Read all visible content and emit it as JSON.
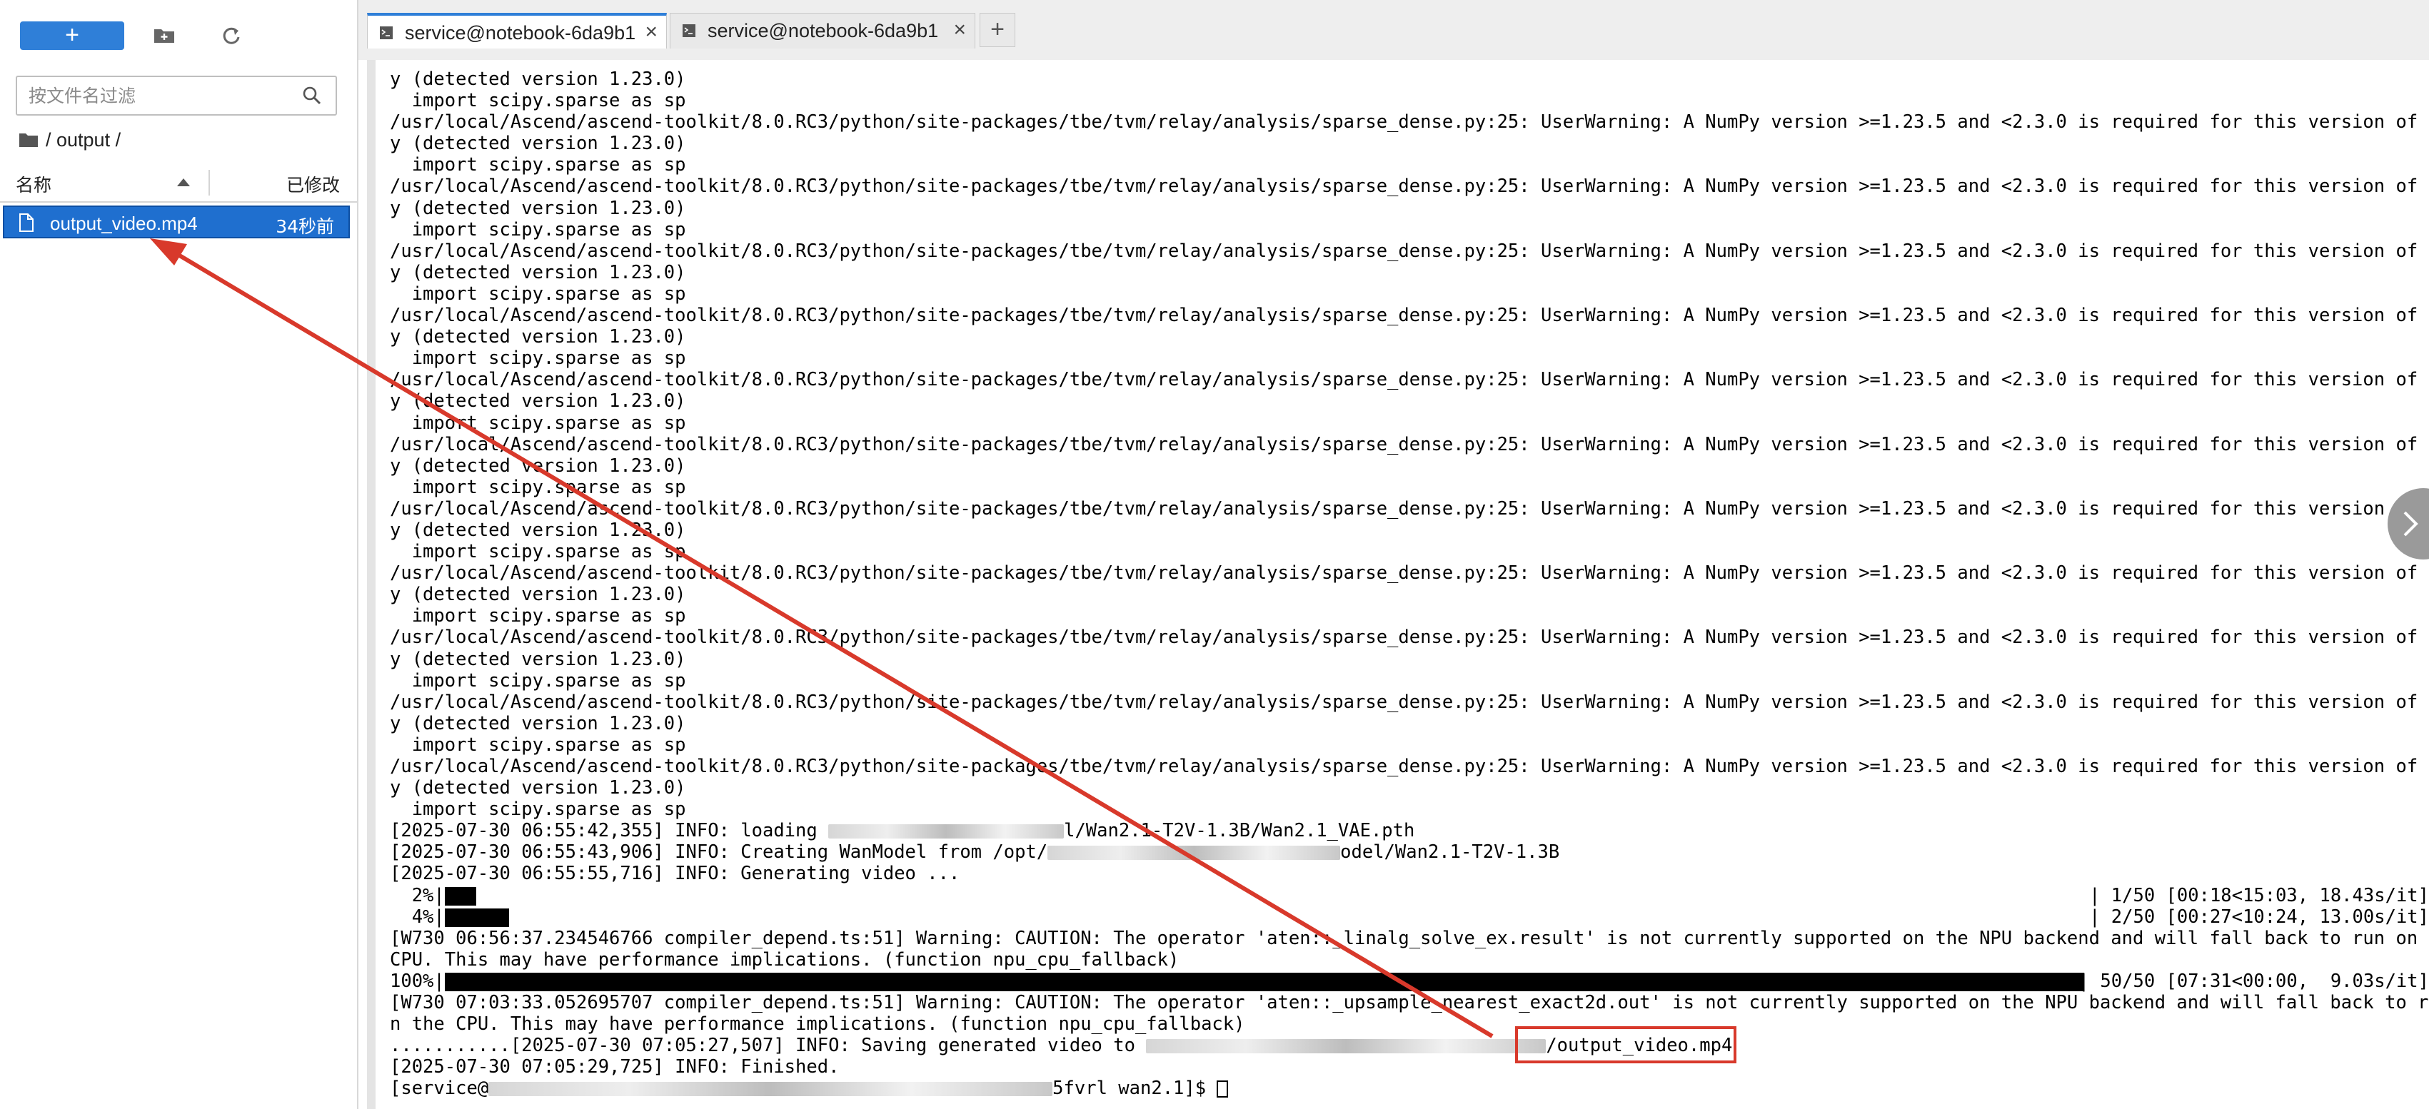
{
  "sidebar": {
    "new_label": "+",
    "filter_placeholder": "按文件名过滤",
    "breadcrumb": "/ output /",
    "col_name": "名称",
    "col_modified": "已修改",
    "files": [
      {
        "name": "output_video.mp4",
        "modified": "34秒前"
      }
    ]
  },
  "tabs": [
    {
      "label": "service@notebook-6da9b1",
      "active": true
    },
    {
      "label": "service@notebook-6da9b1",
      "active": false
    }
  ],
  "tab_add_label": "+",
  "terminal": {
    "warn_first": "y (detected version 1.23.0)",
    "import_line": "  import scipy.sparse as sp",
    "warn_path": "/usr/local/Ascend/ascend-toolkit/8.0.RC3/python/site-packages/tbe/tvm/relay/analysis/sparse_dense.py:25: UserWarning: A NumPy version >=1.23.5 and <2.3.0 is required for this version of SciP",
    "warn_tail": "y (detected version 1.23.0)",
    "info_loading_a": "[2025-07-30 06:55:42,355] INFO: loading ",
    "info_loading_b": "l/Wan2.1-T2V-1.3B/Wan2.1_VAE.pth",
    "info_creating_a": "[2025-07-30 06:55:43,906] INFO: Creating WanModel from /opt/",
    "info_creating_b": "odel/Wan2.1-T2V-1.3B",
    "info_generating": "[2025-07-30 06:55:55,716] INFO: Generating video ...",
    "prog1_pct": "  2%|",
    "prog1_stat": "| 1/50 [00:18<15:03, 18.43s/it]",
    "prog2_pct": "  4%|",
    "prog2_stat": "| 2/50 [00:27<10:24, 13.00s/it]",
    "warn_linalg_1": "[W730 06:56:37.234546766 compiler_depend.ts:51] Warning: CAUTION: The operator 'aten::_linalg_solve_ex.result' is not currently supported on the NPU backend and will fall back to run on the",
    "warn_linalg_2": "CPU. This may have performance implications. (function npu_cpu_fallback)",
    "prog3_pct": "100%|",
    "prog3_stat": "| 50/50 [07:31<00:00,  9.03s/it]",
    "warn_upsample_1": "[W730 07:03:33.052695707 compiler_depend.ts:51] Warning: CAUTION: The operator 'aten::_upsample_nearest_exact2d.out' is not currently supported on the NPU backend and will fall back to run o",
    "warn_upsample_2": "n the CPU. This may have performance implications. (function npu_cpu_fallback)",
    "saving_a": "...........[2025-07-30 07:05:27,507] INFO: Saving generated video to ",
    "saving_b": "/output_video.mp4",
    "finished": "[2025-07-30 07:05:29,725] INFO: Finished.",
    "prompt_a": "[service@",
    "prompt_b": "5fvrl wan2.1]$ "
  },
  "colors": {
    "accent": "#2f7fd8",
    "selection": "#1f6fcf",
    "annotation_red": "#d8392b",
    "progress": "#000000"
  }
}
